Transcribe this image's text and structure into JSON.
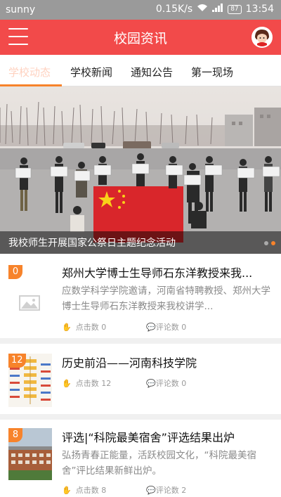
{
  "status_bar": {
    "carrier": "sunny",
    "speed": "0.15K/s",
    "battery": "87",
    "time": "13:54"
  },
  "header": {
    "title": "校园资讯"
  },
  "tabs": [
    {
      "label": "学校动态"
    },
    {
      "label": "学校新闻"
    },
    {
      "label": "通知公告"
    },
    {
      "label": "第一现场"
    }
  ],
  "banner": {
    "caption": "我校师生开展国家公祭日主题纪念活动"
  },
  "news": [
    {
      "badge": "0",
      "title": "郑州大学博士生导师石东洋教授来我...",
      "desc": "应数学科学学院邀请，河南省特聘教授、郑州大学博士生导师石东洋教授来我校讲学...",
      "clicks": "点击数 0",
      "comments": "评论数 0"
    },
    {
      "badge": "12",
      "title": "历史前沿——河南科技学院",
      "desc": "",
      "clicks": "点击数 12",
      "comments": "评论数 0"
    },
    {
      "badge": "8",
      "title": "评选|“科院最美宿舍”评选结果出炉",
      "desc": "弘扬青春正能量，活跃校园文化，“科院最美宿舍”评比结果新鲜出炉。",
      "clicks": "点击数 8",
      "comments": "评论数 2"
    }
  ]
}
